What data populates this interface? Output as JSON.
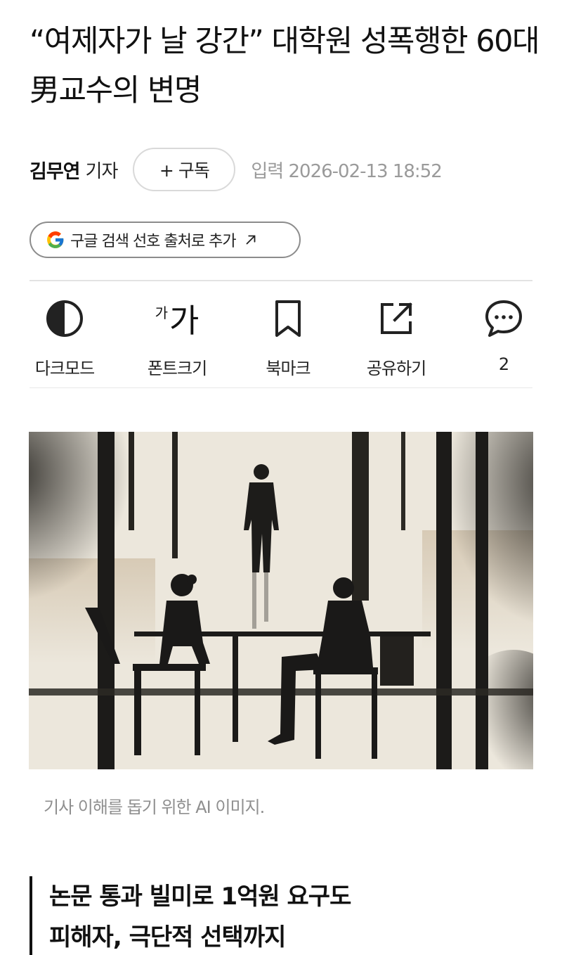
{
  "article": {
    "headline": "“여제자가 날 강간” 대학원 성폭행한 60대 男교수의 변명",
    "reporter_name": "김무연",
    "reporter_role": "기자",
    "subscribe_label": "+ 구독",
    "input_time": "입력 2026-02-13 18:52"
  },
  "google_chip": {
    "label": "구글 검색 선호 출처로 추가",
    "arrow": "↗"
  },
  "toolbar": {
    "dark_mode": "다크모드",
    "font_small": "가",
    "font_big": "가",
    "font_size": "폰트크기",
    "bookmark": "북마크",
    "share": "공유하기",
    "comments_count": "2"
  },
  "image": {
    "caption": "기사 이해를 돕기 위한 AI 이미지."
  },
  "subheads": [
    "논문 통과 빌미로 1억원 요구도",
    "피해자, 극단적 선택까지"
  ],
  "icons": [
    "half-circle-icon",
    "font-size-icon",
    "bookmark-icon",
    "share-icon",
    "comment-icon",
    "google-logo-icon",
    "external-arrow-icon"
  ]
}
